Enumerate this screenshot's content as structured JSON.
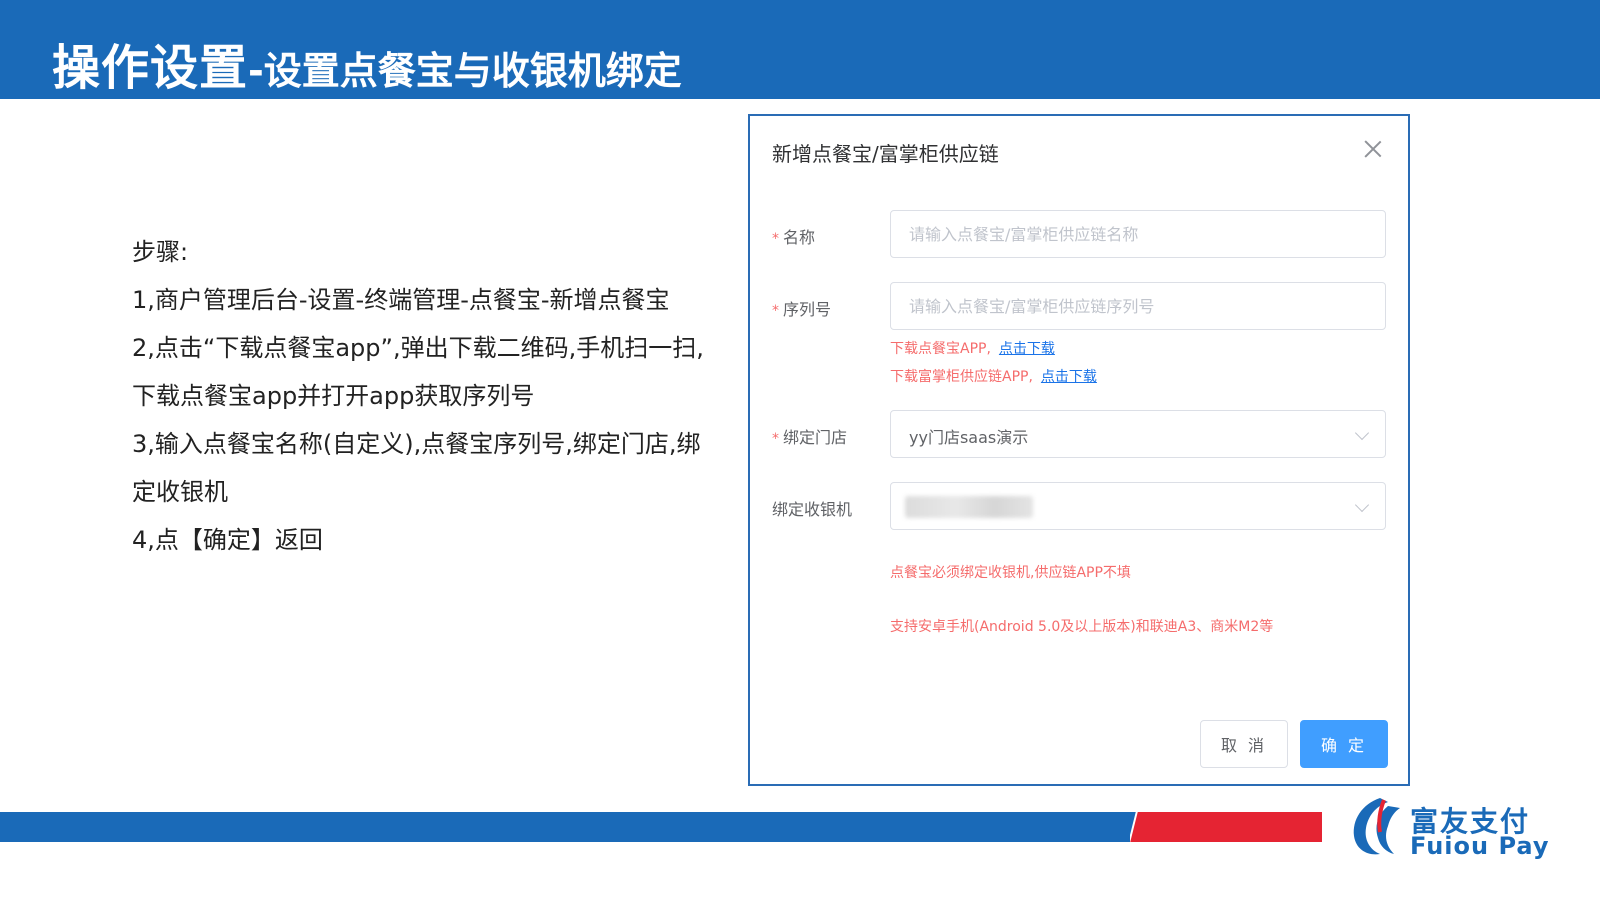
{
  "header": {
    "title_main": "操作设置",
    "title_sub": "-设置点餐宝与收银机绑定"
  },
  "steps": {
    "heading": "步骤:",
    "items": [
      "1,商户管理后台-设置-终端管理-点餐宝-新增点餐宝",
      "2,点击“下载点餐宝app”,弹出下载二维码,手机扫一扫,下载点餐宝app并打开app获取序列号",
      "3,输入点餐宝名称(自定义),点餐宝序列号,绑定门店,绑定收银机",
      "4,点【确定】返回"
    ]
  },
  "dialog": {
    "title": "新增点餐宝/富掌柜供应链",
    "name": {
      "required_mark": "*",
      "label": "名称",
      "placeholder": "请输入点餐宝/富掌柜供应链名称",
      "value": ""
    },
    "serial": {
      "required_mark": "*",
      "label": "序列号",
      "placeholder": "请输入点餐宝/富掌柜供应链序列号",
      "value": ""
    },
    "download_hint_1": {
      "text": "下载点餐宝APP,",
      "link": "点击下载"
    },
    "download_hint_2": {
      "text": "下载富掌柜供应链APP,",
      "link": "点击下载"
    },
    "store": {
      "required_mark": "*",
      "label": "绑定门店",
      "value": "yy门店saas演示"
    },
    "cashier": {
      "label": "绑定收银机",
      "value": ""
    },
    "note_1": "点餐宝必须绑定收银机,供应链APP不填",
    "note_2": "支持安卓手机(Android 5.0及以上版本)和联迪A3、商米M2等",
    "cancel_label": "取 消",
    "ok_label": "确 定"
  },
  "footer": {
    "logo_cn": "富友支付",
    "logo_en": "Fuiou Pay"
  },
  "colors": {
    "brand_blue": "#1a6ab8",
    "brand_red": "#e52433",
    "primary_button": "#409eff",
    "hint_red": "#f56c6c",
    "link_blue": "#1a73e8"
  }
}
